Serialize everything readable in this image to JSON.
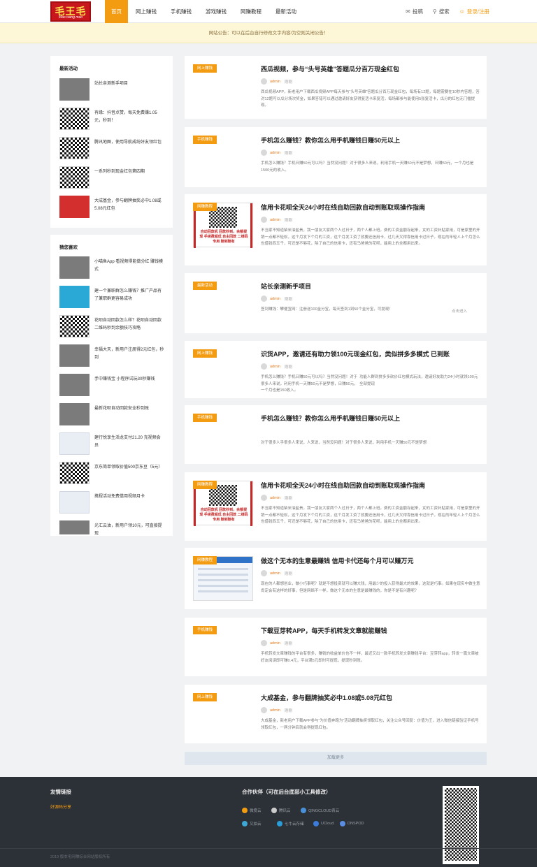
{
  "header": {
    "logo_text": "毛王毛",
    "logo_sub": "Mao wang mao",
    "nav": [
      "首页",
      "网上赚钱",
      "手机赚钱",
      "游戏赚钱",
      "网赚教程",
      "最新活动"
    ],
    "contribute": "投稿",
    "search": "搜索",
    "login": "登录/注册"
  },
  "notice": "网站公告：可以在后台自行修改文字内容/为空则关闭公告！",
  "sidebar": {
    "latest_title": "最新活动",
    "latest": [
      {
        "title": "站长亲测新手项目",
        "thumb": "gray"
      },
      {
        "title": "有缘：抖音点赞，每天免费赚1.05元，秒到！",
        "thumb": "qr"
      },
      {
        "title": "腾讯地图，使用导航成纷好友领红包",
        "thumb": "qr"
      },
      {
        "title": "一系列秒到现金红包第四期",
        "thumb": "qr"
      },
      {
        "title": "大成基金，参与翻牌抽奖必中1.08或5.08元红包",
        "thumb": "red"
      }
    ],
    "hot_title": "猜您喜欢",
    "hot": [
      {
        "title": "小喵鱼App 看视频得能做分红 赚钱模式",
        "thumb": "gray"
      },
      {
        "title": "建一个兼职群怎么赚钱？推广产品有了兼职群更容易成功",
        "thumb": "blue"
      },
      {
        "title": "花呗自动回款怎么样？花呗自动回款二维码秒到余额技巧攻略",
        "thumb": "qr"
      },
      {
        "title": "幸福大天，新用户注册得2元红包，秒到",
        "thumb": "gray"
      },
      {
        "title": "手中赚钱宝 小程序试玩30秒赚钱",
        "thumb": "gray"
      },
      {
        "title": "最新花呗自动回款安全秒到账",
        "thumb": "gray"
      },
      {
        "title": "建行悦享生活龙支付21.20 充视频会员",
        "thumb": "light"
      },
      {
        "title": "京东简单领取价值500京东豆（5元）",
        "thumb": "qr"
      },
      {
        "title": "携程活动免费借用视频月卡",
        "thumb": "light"
      },
      {
        "title": "光汇云油，新用户领10元，可直接提现",
        "thumb": "gray"
      }
    ]
  },
  "posts": [
    {
      "tag": "网上赚钱",
      "title": "西瓜视频，参与“头号英雄”答题瓜分百万现金红包",
      "author": "admin",
      "date": "刚刚",
      "excerpt": "西瓜视频APP，新老用户下载西瓜视频APP每天参与“头号英雄”答题瓜分百万现金红包，每场有12题，每题需要在10秒内答题，答对12题可以瓜分场次奖金，如果答错可以通过邀请好友获得复活卡来复活，每场都参与能使用5张复活卡，瓜分的红包无门槛提现。"
    },
    {
      "tag": "手机赚钱",
      "title": "手机怎么赚钱？教你怎么用手机赚钱日赚50元以上",
      "author": "admin",
      "date": "刚刚",
      "excerpt": "手机怎么赚钱？手机日赚50元可以吗？当然没问题！对于很多人来说，利用手机一天赚50元不是梦想，日赚50元，一个月也是1500元的收入。"
    },
    {
      "tag": "网赚教程",
      "title": "信用卡花呗全天24小时在线自助回款自动到账取现操作指南",
      "author": "admin",
      "date": "刚刚",
      "excerpt": "不当家不知道柴米油盐贵，我一朋友大家两个人过日子，两个人都上班。费的工资金额存起来，女的工资补贴家用，可是家里的开销一点都不轻松，这个月发下个月的工资，这个月发工资了就要还信用卡，过几天又得靠信用卡过日子。现在的年轻人上个月怎么也借钱四五千，可还是不够花，除了自己的信用卡，还有马爸爸的花呗，能用上的全都用出来。",
      "img_caption": "自动回款机 回款秒到，余额提现 手续费超低 自主回款 二维码专用 随到随有"
    },
    {
      "tag": "最新活动",
      "title": "站长亲测新手项目",
      "author": "admin",
      "date": "刚刚",
      "excerpt": "签到赚钱：攀便宜网：注册送100金分宝，每天签到1到50个金分宝，可提现！",
      "readmore": "点击进入"
    },
    {
      "tag": "网上赚钱",
      "title": "识货APP，邀请还有助力领100元现金红包，类似拼多多模式 已到账",
      "author": "admin",
      "date": "刚刚",
      "excerpt": "手机怎么赚钱？手机日赚50元可以吗？当然没问题！对于很多人来说，利用手机一天赚50元不是梦想，日赚50元，一个月也是150收入。",
      "excerpt2": "功能人群到拼多多砍价红包模式玩法，邀请好友助力24小时就领100元全部提现"
    },
    {
      "tag": "手机赚钱",
      "title": "手机怎么赚钱？教你怎么用手机赚钱日赚50元以上",
      "author": "",
      "date": "",
      "excerpt": "对于很多人手很多人来说，人来说，当然没问题！对于很多人来说，利用手机一天赚50元不是梦想"
    },
    {
      "tag": "网赚教程",
      "title": "信用卡花呗全天24小时在线自助回款自动到账取现操作指南",
      "author": "admin",
      "date": "刚刚",
      "excerpt": "不当家不知道柴米油盐贵，我一朋友大家两个人过日子，两个人都上班。费的工资金额存起来，女的工资补贴家用，可是家里的开销一点都不轻松，这个月发下个月的工资，这个月发工资了就要还信用卡，过几天又得靠信用卡过日子。现在的年轻人上个月怎么也借钱四五千，可还是不够花，除了自己的信用卡，还有马爸爸的花呗，能用上的全都用出来。",
      "img_caption": "自动回款机 回款秒到，余额提现 手续费超低 自主回款 二维码专用 随到随有"
    },
    {
      "tag": "网赚教程",
      "title": "做这个无本的生意最赚钱 信用卡代还每个月可以赚万元",
      "author": "admin",
      "date": "刚刚",
      "excerpt": "现在的人都想创业，做小巧事呢？就是不想投资就可以赚大钱，用最少的投入获得最大的效果，这就是巧事。如果在现实中做生意肯定会有这样的好事，但是网络不一样，做这个无本的生意是最赚钱的，你是不是有兴趣呢？"
    },
    {
      "tag": "手机赚钱",
      "title": "下载豆芽转APP，每天手机转发文章就能赚钱",
      "author": "admin",
      "date": "刚刚",
      "excerpt": "手机转发文章赚钱的平台有很多，赚钱的收益单价也不一样，最近又出一款手机转发文章赚钱平台：豆芽转app，转发一篇文章被好友阅读即可赚0.4元，平台满5元即时可提现，提现秒到账。"
    },
    {
      "tag": "网上赚钱",
      "title": "大成基金，参与翻牌抽奖必中1.08或5.08元红包",
      "author": "admin",
      "date": "刚刚",
      "excerpt": "大成基金，新老用户下载APP参与“为价值奔跑为”活动翻牌抽奖领取红包，关注公众号回复：价值为王，进入微信链接验证手机号领取红包，一两分钟后就会得提现红包。"
    }
  ],
  "load_more": "加载更多",
  "footer": {
    "links_title": "友情链接",
    "links": [
      "好源码分享"
    ],
    "partners_title": "合作伙伴（可在后台底部小工具修改）",
    "partners": [
      "微度云",
      "腾讯云",
      "QINGCLOUD青云",
      "又拍云",
      "七牛云存储",
      "UCloud",
      "DNSPOD"
    ],
    "copyright": "2019 版本毛网赚综合网站版权所有"
  },
  "colors": {
    "accent": "#f39c12",
    "footer_bg": "#2c3037",
    "notice_bg": "#fdf7d8"
  }
}
